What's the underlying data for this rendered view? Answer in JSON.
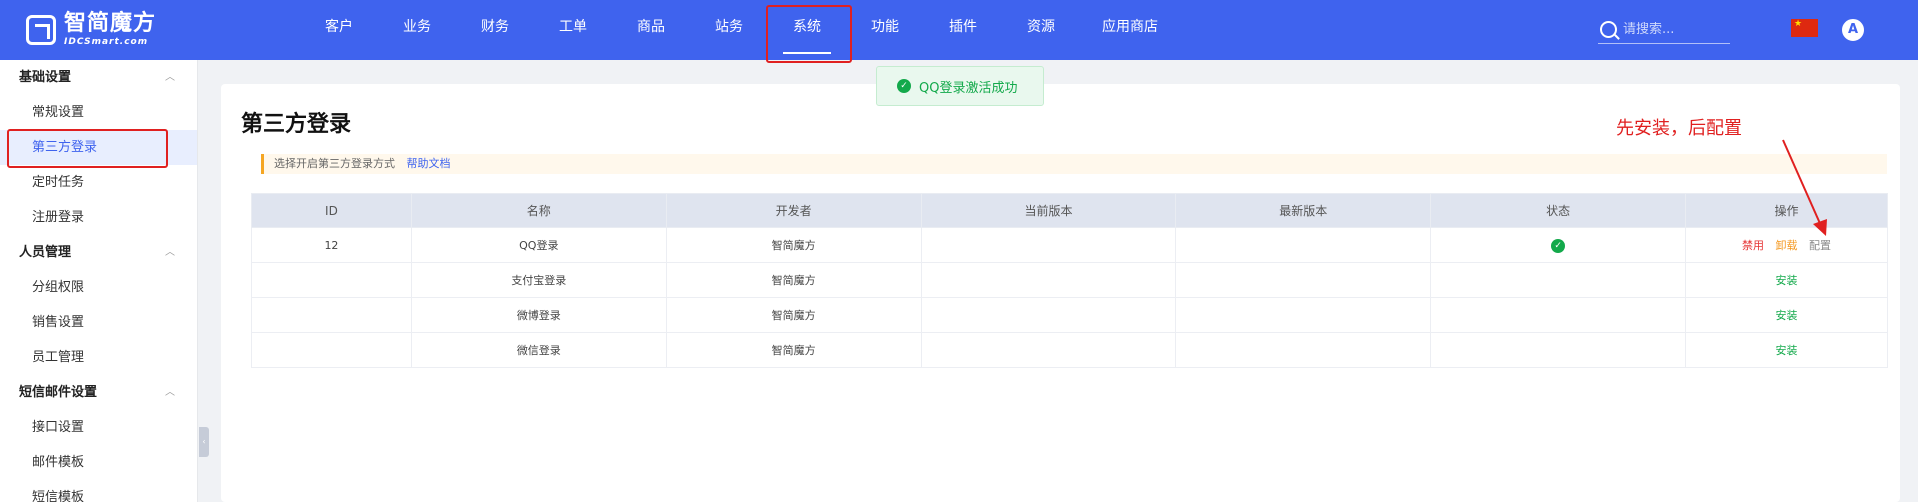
{
  "brand": {
    "name_cn": "智简魔方",
    "name_en": "IDCSmart.com"
  },
  "nav": [
    {
      "label": "客户",
      "active": false
    },
    {
      "label": "业务",
      "active": false
    },
    {
      "label": "财务",
      "active": false
    },
    {
      "label": "工单",
      "active": false
    },
    {
      "label": "商品",
      "active": false
    },
    {
      "label": "站务",
      "active": false
    },
    {
      "label": "系统",
      "active": true
    },
    {
      "label": "功能",
      "active": false
    },
    {
      "label": "插件",
      "active": false
    },
    {
      "label": "资源",
      "active": false
    },
    {
      "label": "应用商店",
      "active": false
    }
  ],
  "search": {
    "placeholder": "请搜索..."
  },
  "user": {
    "avatar_letter": "A"
  },
  "sidebar": {
    "groups": [
      {
        "label": "基础设置",
        "items": [
          "常规设置",
          "第三方登录",
          "定时任务",
          "注册登录"
        ]
      },
      {
        "label": "人员管理",
        "items": [
          "分组权限",
          "销售设置",
          "员工管理"
        ]
      },
      {
        "label": "短信邮件设置",
        "items": [
          "接口设置",
          "邮件模板",
          "短信模板"
        ]
      }
    ],
    "active_item": "第三方登录"
  },
  "page": {
    "title": "第三方登录",
    "notice": "选择开启第三方登录方式",
    "help_link": "帮助文档"
  },
  "table": {
    "columns": [
      "ID",
      "名称",
      "开发者",
      "当前版本",
      "最新版本",
      "状态",
      "操作"
    ],
    "rows": [
      {
        "id": "12",
        "name": "QQ登录",
        "developer": "智简魔方",
        "current_version": "",
        "latest_version": "",
        "status": "enabled",
        "actions": [
          "禁用",
          "卸载",
          "配置"
        ]
      },
      {
        "id": "",
        "name": "支付宝登录",
        "developer": "智简魔方",
        "current_version": "",
        "latest_version": "",
        "status": "",
        "actions": [
          "安装"
        ]
      },
      {
        "id": "",
        "name": "微博登录",
        "developer": "智简魔方",
        "current_version": "",
        "latest_version": "",
        "status": "",
        "actions": [
          "安装"
        ]
      },
      {
        "id": "",
        "name": "微信登录",
        "developer": "智简魔方",
        "current_version": "",
        "latest_version": "",
        "status": "",
        "actions": [
          "安装"
        ]
      }
    ]
  },
  "toast": {
    "message": "QQ登录激活成功",
    "icon": "check-circle-icon"
  },
  "annotation": {
    "text": "先安装，后配置",
    "color": "#e02020"
  },
  "colors": {
    "primary": "#3f63ee",
    "success": "#13a94b",
    "danger": "#e63535",
    "warning": "#f59a23"
  }
}
